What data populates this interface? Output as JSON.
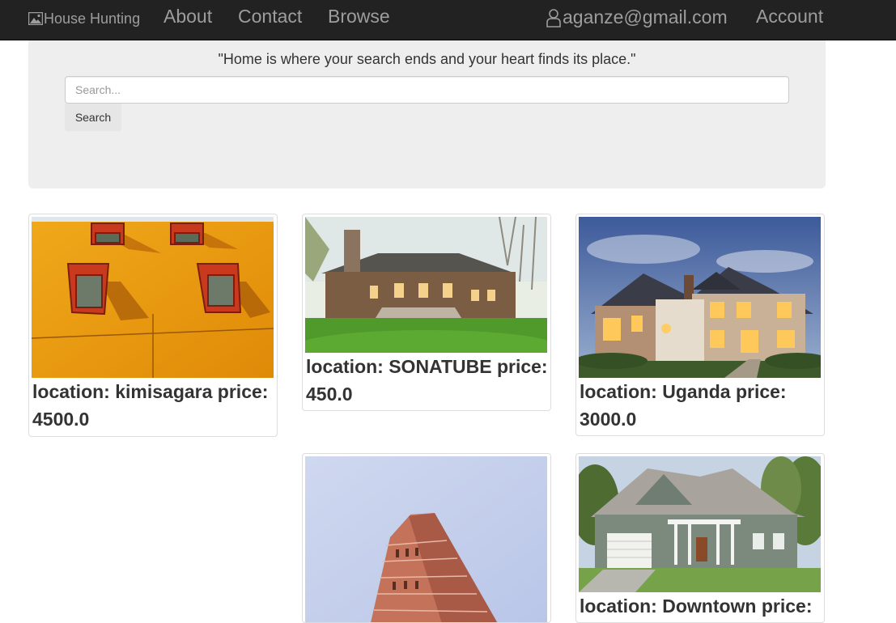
{
  "navbar": {
    "brand": "House Hunting",
    "links": [
      "About",
      "Contact",
      "Browse"
    ],
    "user_email": "aganze@gmail.com",
    "account": "Account"
  },
  "hero": {
    "quote": "\"Home is where your search ends and your heart finds its place.\"",
    "search_placeholder": "Search...",
    "search_button": "Search"
  },
  "listings": [
    {
      "caption": "location: kimisagara price: 4500.0",
      "image": "yellow-wall-windows-photo"
    },
    {
      "caption": "location: SONATUBE price: 450.0",
      "image": "stone-cottage-photo"
    },
    {
      "caption": "location: Uganda price: 3000.0",
      "image": "lit-mansion-dusk-photo"
    },
    {
      "caption": "",
      "image": "flatiron-building-photo"
    },
    {
      "caption": "location: Downtown price:",
      "image": "green-suburban-house-photo"
    }
  ],
  "colors": {
    "navbar_bg": "#222222",
    "navbar_text": "#9d9d9d",
    "jumbotron_bg": "#eeeeee"
  }
}
